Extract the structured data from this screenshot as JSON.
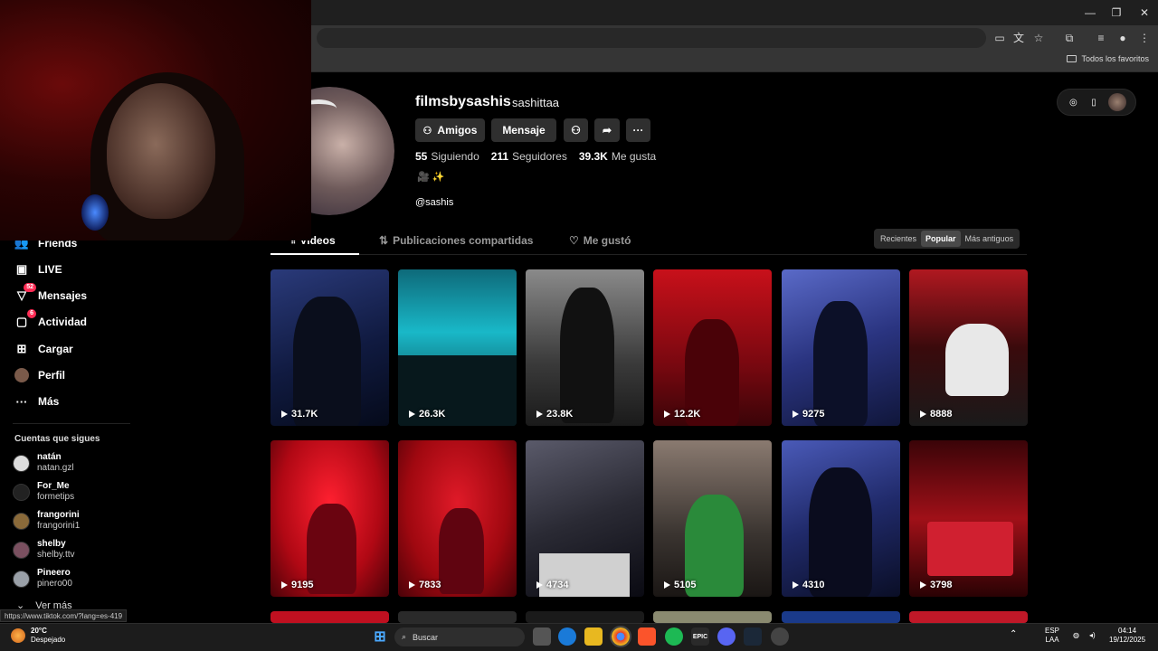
{
  "browser": {
    "bookmarks_folder_label": "Todos los favoritos",
    "status_url": "https://www.tiktok.com/?lang=es-419",
    "window_controls": {
      "minimize": "—",
      "maximize": "❐",
      "close": "✕"
    }
  },
  "sidebar": {
    "items": [
      {
        "label": "Friends",
        "icon": "friends-icon"
      },
      {
        "label": "LIVE",
        "icon": "live-icon"
      },
      {
        "label": "Mensajes",
        "icon": "messages-icon",
        "badge": "52"
      },
      {
        "label": "Actividad",
        "icon": "activity-icon",
        "badge": "6"
      },
      {
        "label": "Cargar",
        "icon": "upload-icon"
      },
      {
        "label": "Perfil",
        "icon": "profile-avatar"
      },
      {
        "label": "Más",
        "icon": "more-icon"
      }
    ],
    "following_heading": "Cuentas que sigues",
    "following": [
      {
        "name": "natán",
        "handle": "natan.gzl"
      },
      {
        "name": "For_Me",
        "handle": "formetips"
      },
      {
        "name": "frangorini",
        "handle": "frangorini1"
      },
      {
        "name": "shelby",
        "handle": "shelby.ttv"
      },
      {
        "name": "Pineero",
        "handle": "pinero00"
      }
    ],
    "see_more": "Ver más"
  },
  "profile": {
    "username": "filmsbysashis",
    "nickname": "sashittaa",
    "buttons": {
      "friends": "Amigos",
      "message": "Mensaje"
    },
    "stats": {
      "following_count": "55",
      "following_label": "Siguiendo",
      "followers_count": "211",
      "followers_label": "Seguidores",
      "likes_count": "39.3K",
      "likes_label": "Me gusta"
    },
    "bio_emoji": "🎥 ✨",
    "bio": "@sashis"
  },
  "tabs": {
    "videos": "Videos",
    "reposts": "Publicaciones compartidas",
    "liked": "Me gustó"
  },
  "sort": {
    "options": [
      "Recientes",
      "Popular",
      "Más antiguos"
    ],
    "selected": "Popular"
  },
  "videos": [
    {
      "views": "31.7K"
    },
    {
      "views": "26.3K"
    },
    {
      "views": "23.8K"
    },
    {
      "views": "12.2K"
    },
    {
      "views": "9275"
    },
    {
      "views": "8888"
    },
    {
      "views": "9195"
    },
    {
      "views": "7833"
    },
    {
      "views": "4734"
    },
    {
      "views": "5105"
    },
    {
      "views": "4310"
    },
    {
      "views": "3798"
    }
  ],
  "taskbar": {
    "weather_temp": "20°C",
    "weather_desc": "Despejado",
    "search_placeholder": "Buscar",
    "lang_primary": "ESP",
    "lang_secondary": "LAA",
    "time": "04:14",
    "date": "19/12/2025"
  },
  "colors": {
    "accent": "#fe2c55",
    "background": "#000000",
    "button": "#2f2f2f"
  }
}
